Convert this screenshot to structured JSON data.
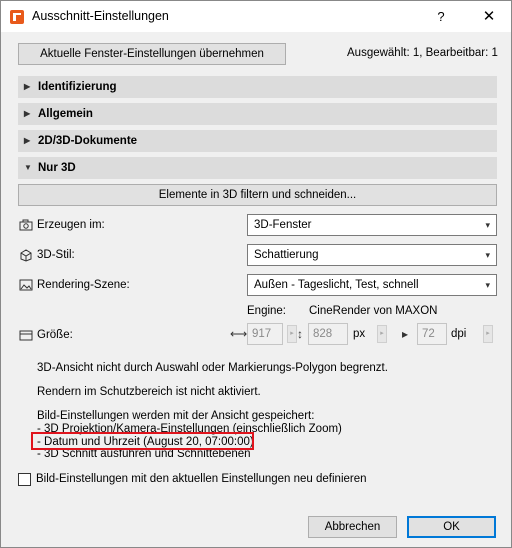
{
  "window": {
    "title": "Ausschnitt-Einstellungen",
    "help_label": "?",
    "close_label": "✕"
  },
  "toolbar": {
    "take_settings_label": "Aktuelle Fenster-Einstellungen übernehmen",
    "status": "Ausgewählt: 1, Bearbeitbar: 1"
  },
  "sections": [
    {
      "label": "Identifizierung",
      "expanded": false
    },
    {
      "label": "Allgemein",
      "expanded": false
    },
    {
      "label": "2D/3D-Dokumente",
      "expanded": false
    },
    {
      "label": "Nur 3D",
      "expanded": true
    }
  ],
  "nur3d": {
    "filter_button_label": "Elemente in 3D filtern und schneiden...",
    "create_in_label": "Erzeugen im:",
    "create_in_value": "3D-Fenster",
    "style_label": "3D-Stil:",
    "style_value": "Schattierung",
    "scene_label": "Rendering-Szene:",
    "scene_value": "Außen - Tageslicht, Test, schnell",
    "engine_label": "Engine:",
    "engine_value": "CineRender von MAXON",
    "size_label": "Größe:",
    "width_value": "917",
    "height_value": "828",
    "size_unit": "px",
    "resolution_value": "72",
    "resolution_unit": "dpi",
    "info_line1": "3D-Ansicht nicht durch Auswahl oder Markierungs-Polygon begrenzt.",
    "info_line2": "Rendern im Schutzbereich ist nicht aktiviert.",
    "saved_heading": "Bild-Einstellungen werden mit der Ansicht gespeichert:",
    "saved_items": [
      "- 3D Projektion/Kamera-Einstellungen (einschließlich Zoom)",
      "- Datum und Uhrzeit (August 20, 07:00:00)",
      "- 3D Schnitt ausführen und Schnittebenen"
    ],
    "redefine_checkbox_label": "Bild-Einstellungen mit den aktuellen Einstellungen neu definieren",
    "redefine_checked": false
  },
  "footer": {
    "cancel_label": "Abbrechen",
    "ok_label": "OK"
  },
  "colors": {
    "highlight_border": "#e0141d",
    "ok_border": "#0078d7"
  }
}
